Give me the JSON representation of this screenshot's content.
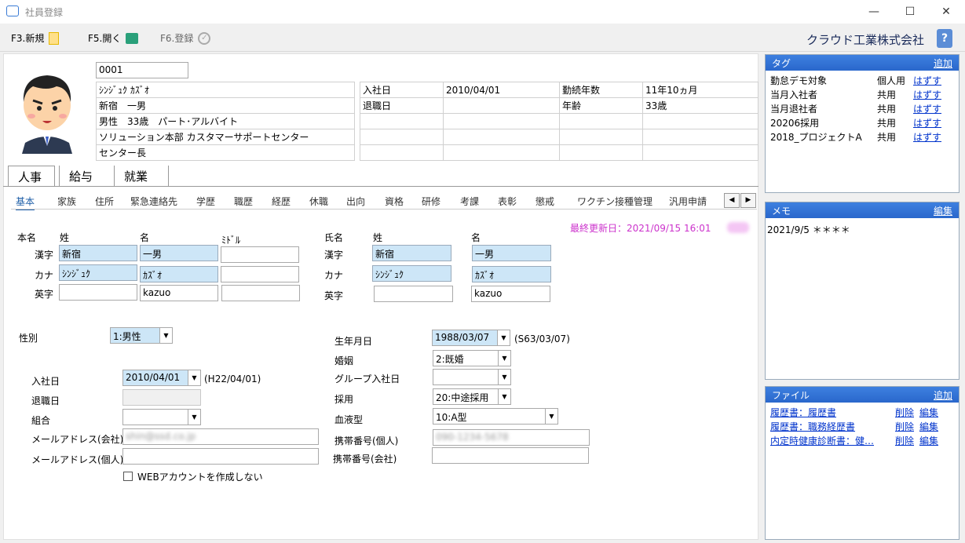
{
  "window": {
    "title": "社員登録",
    "minimize": "—",
    "maximize": "☐",
    "close": "✕"
  },
  "toolbar": {
    "new_label": "F3.新規",
    "open_label": "F5.開く",
    "register_label": "F6.登録",
    "company": "クラウド工業株式会社",
    "help": "?"
  },
  "employee": {
    "code": "0001",
    "kana": "ｼﾝｼﾞｭｸ ｶｽﾞｵ",
    "name": "新宿　一男",
    "attr": "男性　33歳　パート･アルバイト",
    "dept": "ソリューション本部 カスタマーサポートセンター",
    "position": "センター長"
  },
  "summary": {
    "hire_label": "入社日",
    "hire_value": "2010/04/01",
    "tenure_label": "勤続年数",
    "tenure_value": "11年10ヵ月",
    "retire_label": "退職日",
    "retire_value": "",
    "age_label": "年齢",
    "age_value": "33歳"
  },
  "main_tabs": [
    "人事",
    "給与",
    "就業"
  ],
  "sub_tabs": [
    "基本",
    "家族",
    "住所",
    "緊急連絡先",
    "学歴",
    "職歴",
    "経歴",
    "休職",
    "出向",
    "資格",
    "研修",
    "考課",
    "表彰",
    "懲戒",
    "ワクチン接種管理",
    "汎用申請"
  ],
  "last_updated": "最終更新日：2021/09/15 16:01",
  "form": {
    "honmyo_label": "本名",
    "sei_label": "姓",
    "mei_label": "名",
    "middle_label": "ﾐﾄﾞﾙ",
    "kanji_label": "漢字",
    "kana_label": "カナ",
    "eiji_label": "英字",
    "sei_kanji": "新宿",
    "mei_kanji": "一男",
    "middle_kanji": "",
    "sei_kana": "ｼﾝｼﾞｭｸ",
    "mei_kana": "ｶｽﾞｵ",
    "middle_kana": "",
    "sei_eiji": "",
    "mei_eiji": "kazuo",
    "middle_eiji": "",
    "shimei_label": "氏名",
    "s_sei_kanji": "新宿",
    "s_mei_kanji": "一男",
    "s_sei_kana": "ｼﾝｼﾞｭｸ",
    "s_mei_kana": "ｶｽﾞｵ",
    "s_sei_eiji": "",
    "s_mei_eiji": "kazuo",
    "gender_label": "性別",
    "gender_value": "1:男性",
    "birth_label": "生年月日",
    "birth_value": "1988/03/07",
    "birth_wareki": "(S63/03/07)",
    "marriage_label": "婚姻",
    "marriage_value": "2:既婚",
    "group_hire_label": "グループ入社日",
    "group_hire_value": "",
    "hire_label": "入社日",
    "hire_value": "2010/04/01",
    "hire_wareki": "(H22/04/01)",
    "retire_label": "退職日",
    "recruit_label": "採用",
    "recruit_value": "20:中途採用",
    "union_label": "組合",
    "union_value": "",
    "blood_label": "血液型",
    "blood_value": "10:A型",
    "mail_company_label": "メールアドレス(会社)",
    "mail_company_value": "shin@ssd.co.jp",
    "mobile_personal_label": "携帯番号(個人)",
    "mobile_personal_value": "090-1234-5678",
    "mail_personal_label": "メールアドレス(個人)",
    "mail_personal_value": "",
    "mobile_company_label": "携帯番号(会社)",
    "mobile_company_value": "",
    "web_account_label": "WEBアカウントを作成しない"
  },
  "tags_panel": {
    "title": "タグ",
    "add": "追加",
    "remove": "はずす",
    "items": [
      {
        "name": "勤怠デモ対象",
        "scope": "個人用"
      },
      {
        "name": "当月入社者",
        "scope": "共用"
      },
      {
        "name": "当月退社者",
        "scope": "共用"
      },
      {
        "name": "20206採用",
        "scope": "共用"
      },
      {
        "name": "2018_プロジェクトA",
        "scope": "共用"
      }
    ]
  },
  "memo_panel": {
    "title": "メモ",
    "edit": "編集",
    "text": "2021/9/5 ＊＊＊＊"
  },
  "files_panel": {
    "title": "ファイル",
    "add": "追加",
    "delete": "削除",
    "edit": "編集",
    "items": [
      "履歴書：履歴書",
      "履歴書：職務経歴書",
      "内定時健康診断書：健…"
    ]
  },
  "colors": {
    "accent": "#2a67cc",
    "field_highlight": "#cde6f7",
    "update_text": "#cc33cc"
  }
}
